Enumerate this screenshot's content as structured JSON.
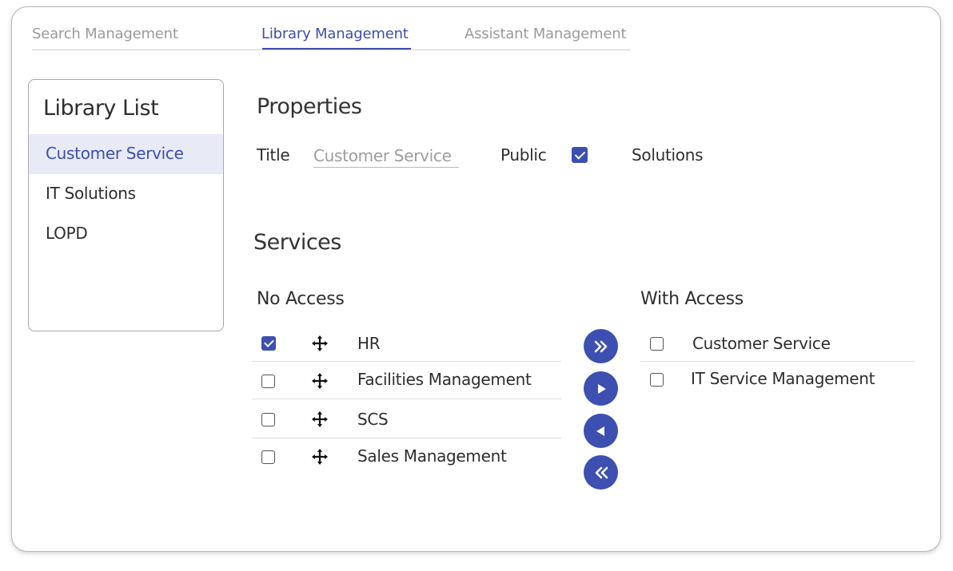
{
  "tabs": [
    {
      "label": "Search Management"
    },
    {
      "label": "Library Management"
    },
    {
      "label": "Assistant Management"
    }
  ],
  "library_list": {
    "title": "Library List",
    "items": [
      {
        "label": "Customer Service"
      },
      {
        "label": "IT Solutions"
      },
      {
        "label": "LOPD"
      }
    ]
  },
  "properties": {
    "heading": "Properties",
    "title_label": "Title",
    "title_value": "Customer Service",
    "public_label": "Public",
    "public_checked": true,
    "solutions_label": "Solutions"
  },
  "services": {
    "heading": "Services",
    "no_access": {
      "heading": "No Access",
      "items": [
        {
          "label": "HR",
          "checked": true
        },
        {
          "label": "Facilities Management",
          "checked": false
        },
        {
          "label": "SCS",
          "checked": false
        },
        {
          "label": "Sales Management",
          "checked": false
        }
      ]
    },
    "with_access": {
      "heading": "With Access",
      "items": [
        {
          "label": "Customer Service",
          "checked": false
        },
        {
          "label": "IT Service Management",
          "checked": false
        }
      ]
    },
    "transfer_buttons": [
      {
        "icon": "double-chevron-right-icon"
      },
      {
        "icon": "triangle-right-icon"
      },
      {
        "icon": "triangle-left-icon"
      },
      {
        "icon": "double-chevron-left-icon"
      }
    ]
  },
  "colors": {
    "accent": "#3d4fb0",
    "selected_bg": "#e8eaf6",
    "muted_text": "#9a9a9a"
  }
}
